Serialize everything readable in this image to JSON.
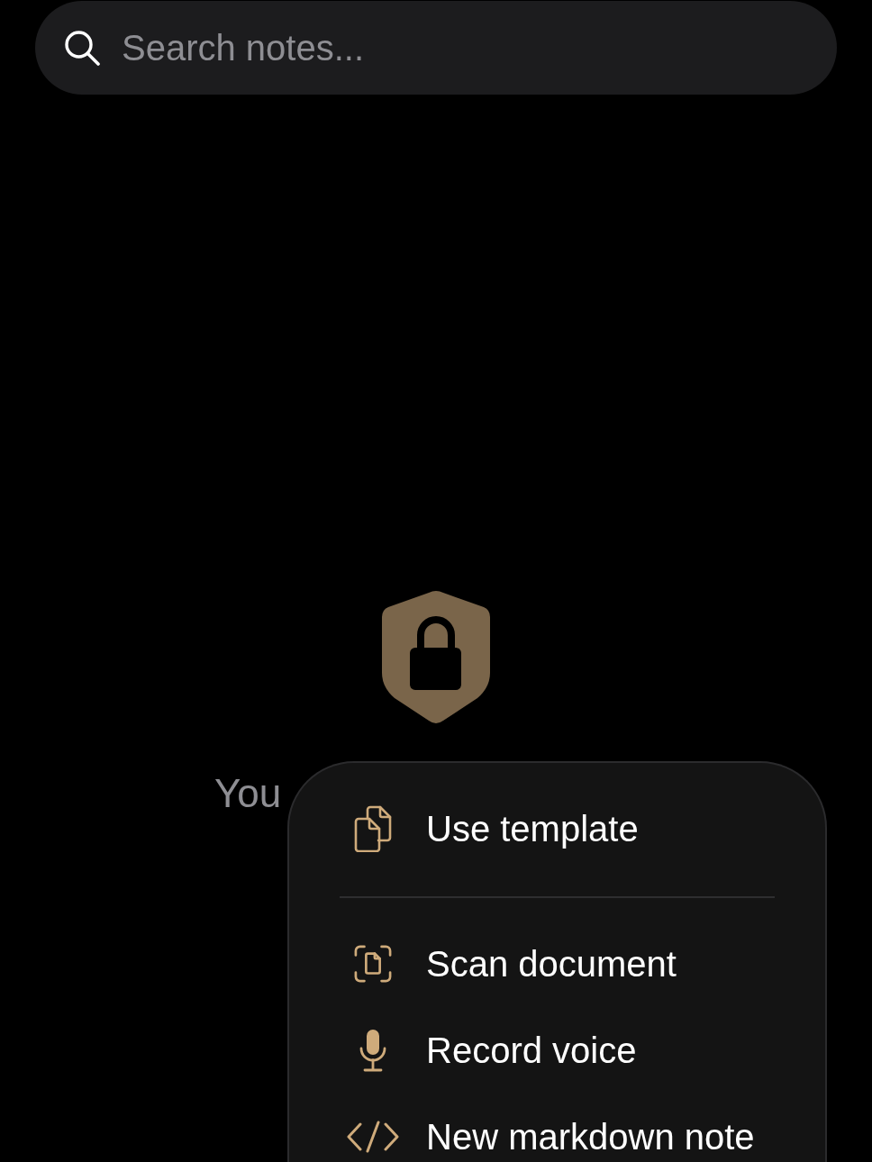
{
  "search": {
    "placeholder": "Search notes..."
  },
  "locked_notice": {
    "message": "You"
  },
  "menu": {
    "groups": [
      {
        "items": [
          {
            "kind": "template",
            "label": "Use template"
          }
        ]
      },
      {
        "items": [
          {
            "kind": "scan",
            "label": "Scan document"
          },
          {
            "kind": "voice",
            "label": "Record voice"
          },
          {
            "kind": "markdown",
            "label": "New markdown note"
          }
        ]
      }
    ]
  }
}
